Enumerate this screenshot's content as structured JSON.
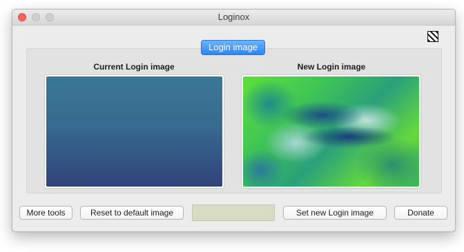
{
  "window": {
    "title": "Loginox"
  },
  "titlebar": {
    "buttons": [
      "close",
      "minimize",
      "zoom"
    ]
  },
  "toolbar": {
    "corner_icon": "hatch-logo-icon"
  },
  "main": {
    "tab_label": "Login image",
    "current_label": "Current Login image",
    "new_label": "New Login image"
  },
  "footer": {
    "more_tools": "More tools",
    "reset": "Reset to default image",
    "field_value": "",
    "set_new": "Set new Login image",
    "donate": "Donate"
  },
  "colors": {
    "accent": "#2a86f7",
    "close": "#fc605c",
    "field_bg": "#d9dbc2"
  }
}
